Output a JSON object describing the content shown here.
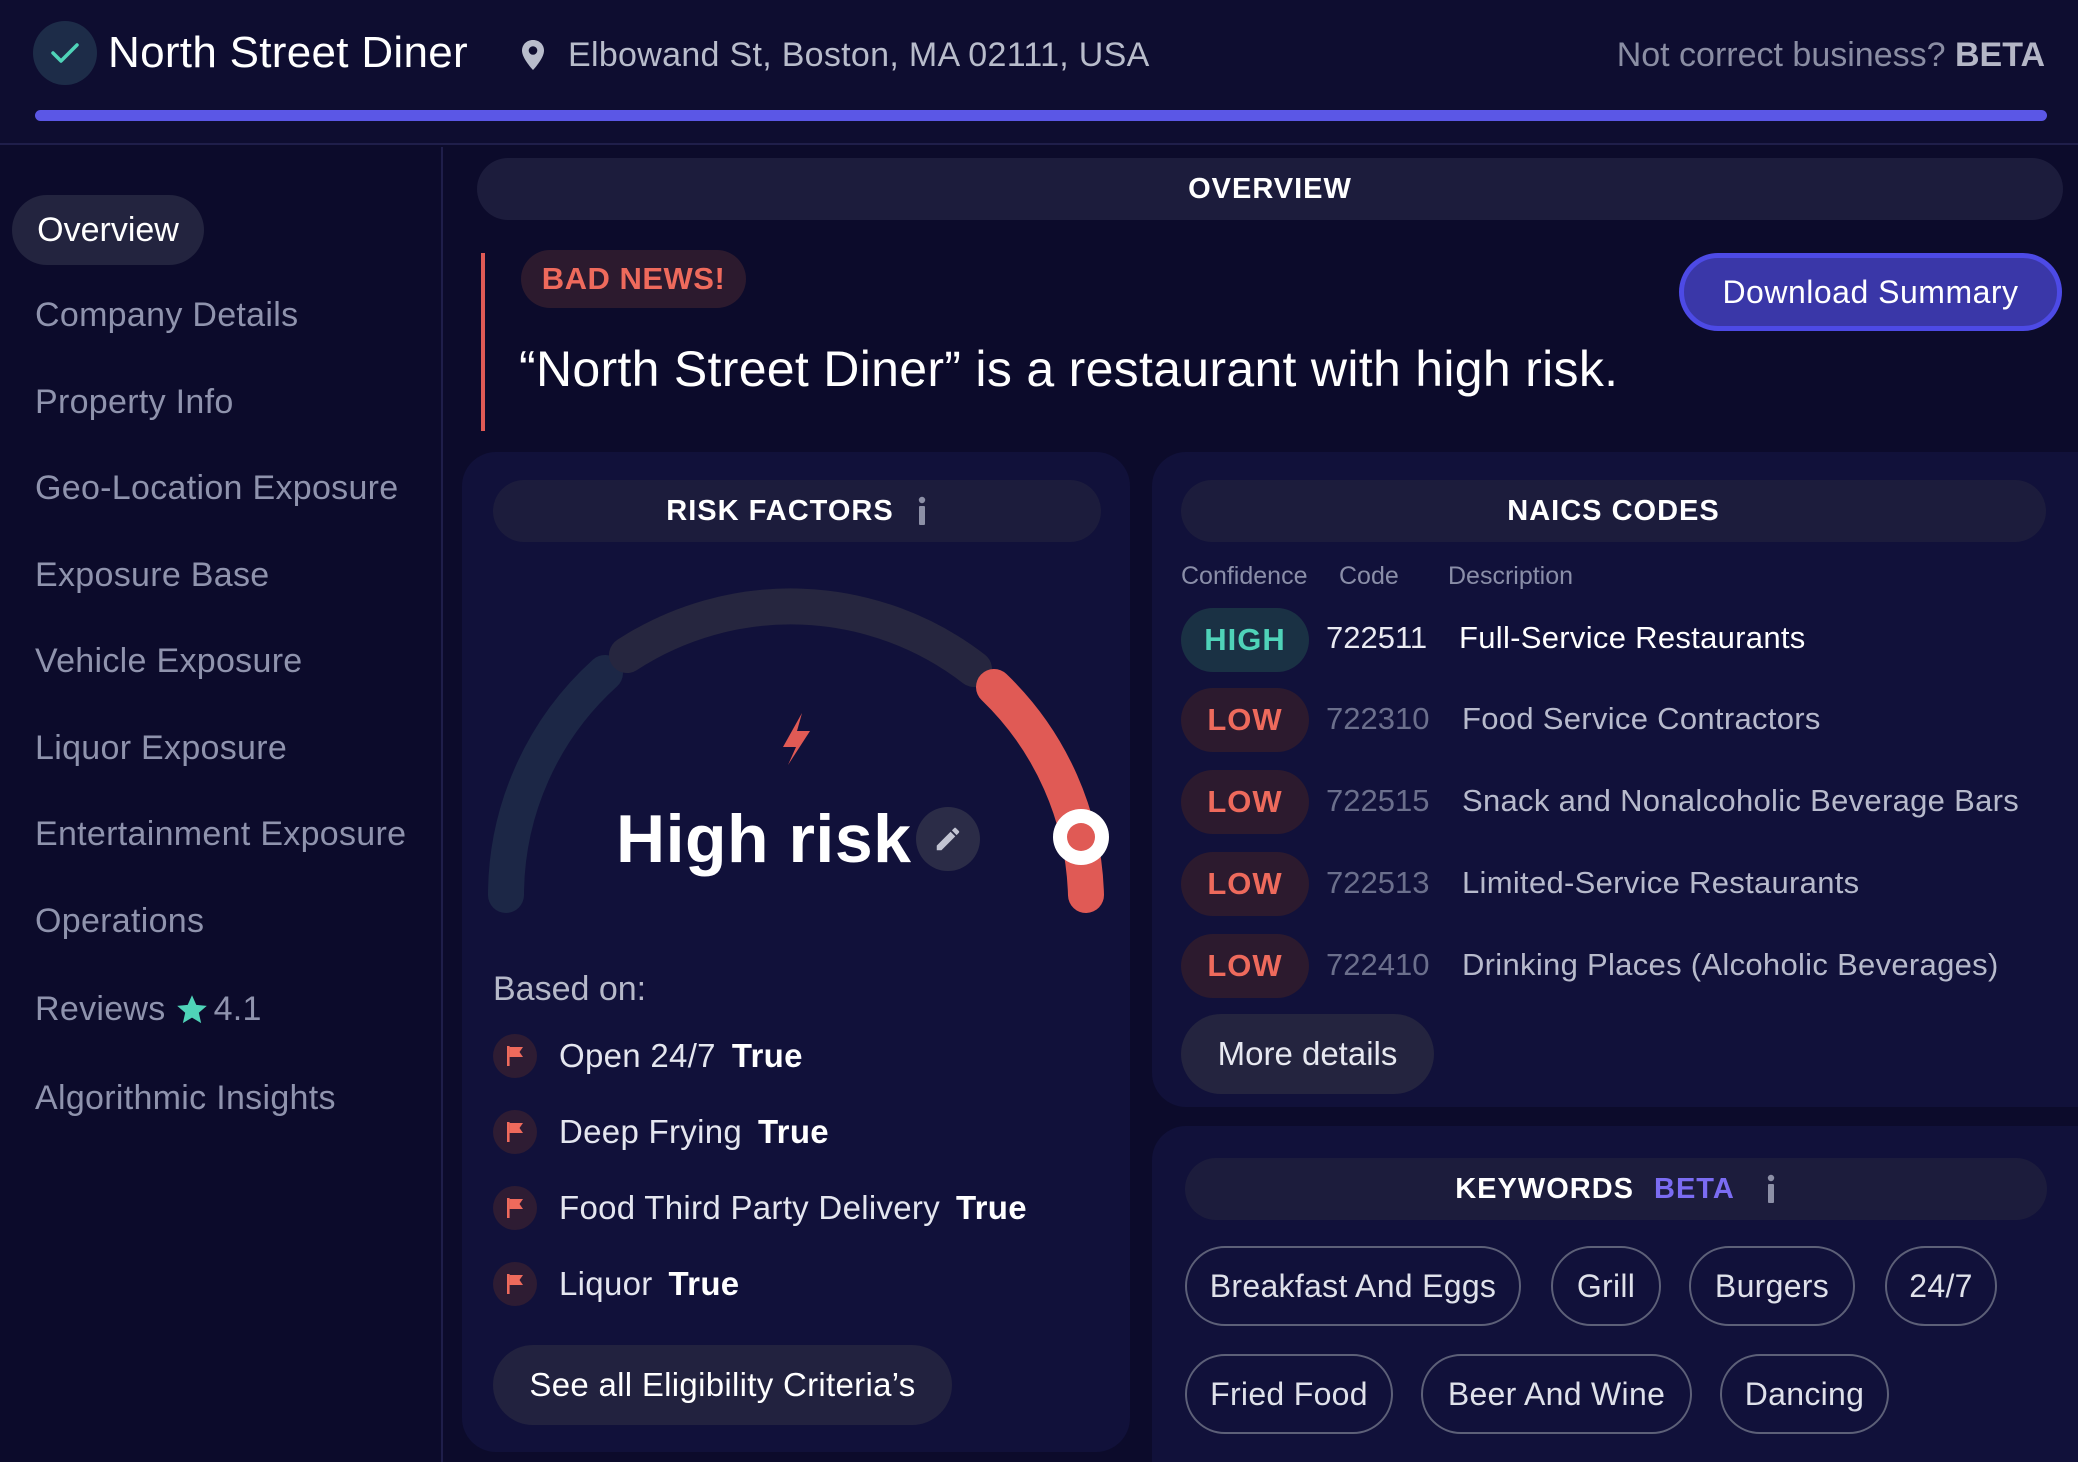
{
  "header": {
    "business_name": "North Street Diner",
    "address": "Elbowand St, Boston, MA 02111, USA",
    "not_correct_label": "Not correct business?",
    "beta_label": "BETA",
    "progress_fraction": 1.0
  },
  "sidebar": {
    "items": [
      {
        "label": "Overview",
        "active": true
      },
      {
        "label": "Company Details"
      },
      {
        "label": "Property Info"
      },
      {
        "label": "Geo-Location Exposure"
      },
      {
        "label": "Exposure Base"
      },
      {
        "label": "Vehicle Exposure"
      },
      {
        "label": "Liquor Exposure"
      },
      {
        "label": "Entertainment Exposure"
      },
      {
        "label": "Operations"
      },
      {
        "label": "Reviews",
        "rating": "4.1"
      },
      {
        "label": "Algorithmic Insights"
      }
    ]
  },
  "overview": {
    "title": "OVERVIEW",
    "badge": "BAD NEWS!",
    "headline": "“North Street Diner” is a restaurant with high risk.",
    "download_label": "Download Summary"
  },
  "risk": {
    "title": "RISK FACTORS",
    "level_label": "High risk",
    "based_on_label": "Based on:",
    "factors": [
      {
        "label": "Open 24/7",
        "value": "True"
      },
      {
        "label": "Deep Frying",
        "value": "True"
      },
      {
        "label": "Food Third Party Delivery",
        "value": "True"
      },
      {
        "label": "Liquor",
        "value": "True"
      }
    ],
    "see_all_label": "See all Eligibility Criteria’s"
  },
  "naics": {
    "title": "NAICS CODES",
    "columns": [
      "Confidence",
      "Code",
      "Description"
    ],
    "rows": [
      {
        "confidence": "HIGH",
        "code": "722511",
        "description": "Full-Service Restaurants"
      },
      {
        "confidence": "LOW",
        "code": "722310",
        "description": "Food Service Contractors"
      },
      {
        "confidence": "LOW",
        "code": "722515",
        "description": "Snack and Nonalcoholic Beverage Bars"
      },
      {
        "confidence": "LOW",
        "code": "722513",
        "description": "Limited-Service Restaurants"
      },
      {
        "confidence": "LOW",
        "code": "722410",
        "description": "Drinking Places (Alcoholic Beverages)"
      }
    ],
    "more_label": "More details"
  },
  "keywords": {
    "title": "KEYWORDS",
    "beta_label": "BETA",
    "items": [
      "Breakfast And Eggs",
      "Grill",
      "Burgers",
      "24/7",
      "Fried Food",
      "Beer And Wine",
      "Dancing"
    ]
  },
  "colors": {
    "background": "#0c0b2b",
    "accent": "#5b57e6",
    "danger": "#ee6a5c",
    "success": "#4fd3b8",
    "star": "#4fd3b8"
  }
}
